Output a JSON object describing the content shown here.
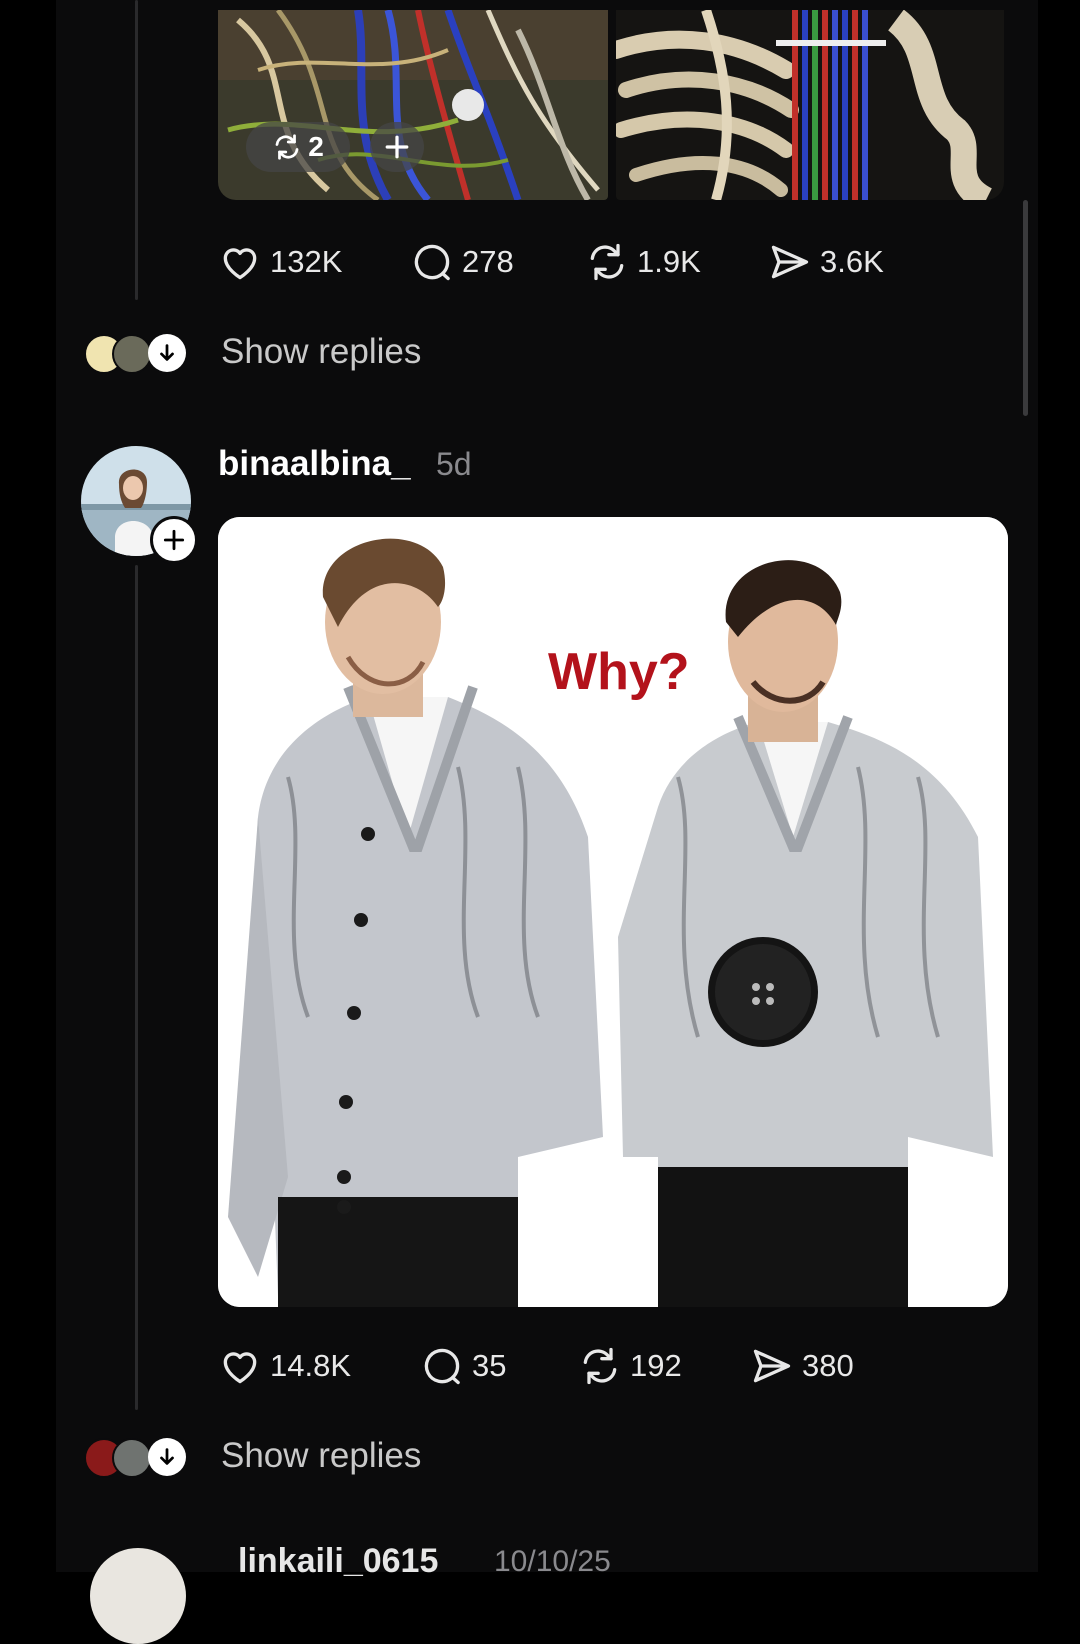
{
  "previous_post": {
    "image_badges": {
      "repost_count": "2",
      "add_icon": "plus-icon"
    },
    "actions": {
      "likes": "132K",
      "comments": "278",
      "reposts": "1.9K",
      "shares": "3.6K"
    },
    "show_replies": "Show replies"
  },
  "post": {
    "username": "binaalbina_",
    "time_ago": "5d",
    "image_caption": "Why?",
    "actions": {
      "likes": "14.8K",
      "comments": "35",
      "reposts": "192",
      "shares": "380"
    },
    "show_replies": "Show replies"
  },
  "next_post": {
    "username": "linkaili_0615",
    "date": "10/10/25"
  },
  "icons": {
    "like": "heart-icon",
    "comment": "comment-bubble-icon",
    "repost": "repost-icon",
    "share": "send-icon",
    "expand": "arrow-down-icon",
    "follow": "plus-icon"
  },
  "colors": {
    "background": "#0b0b0c",
    "text": "#f2f2f2",
    "muted": "#8a8a8e",
    "caption_red": "#b3121b"
  }
}
